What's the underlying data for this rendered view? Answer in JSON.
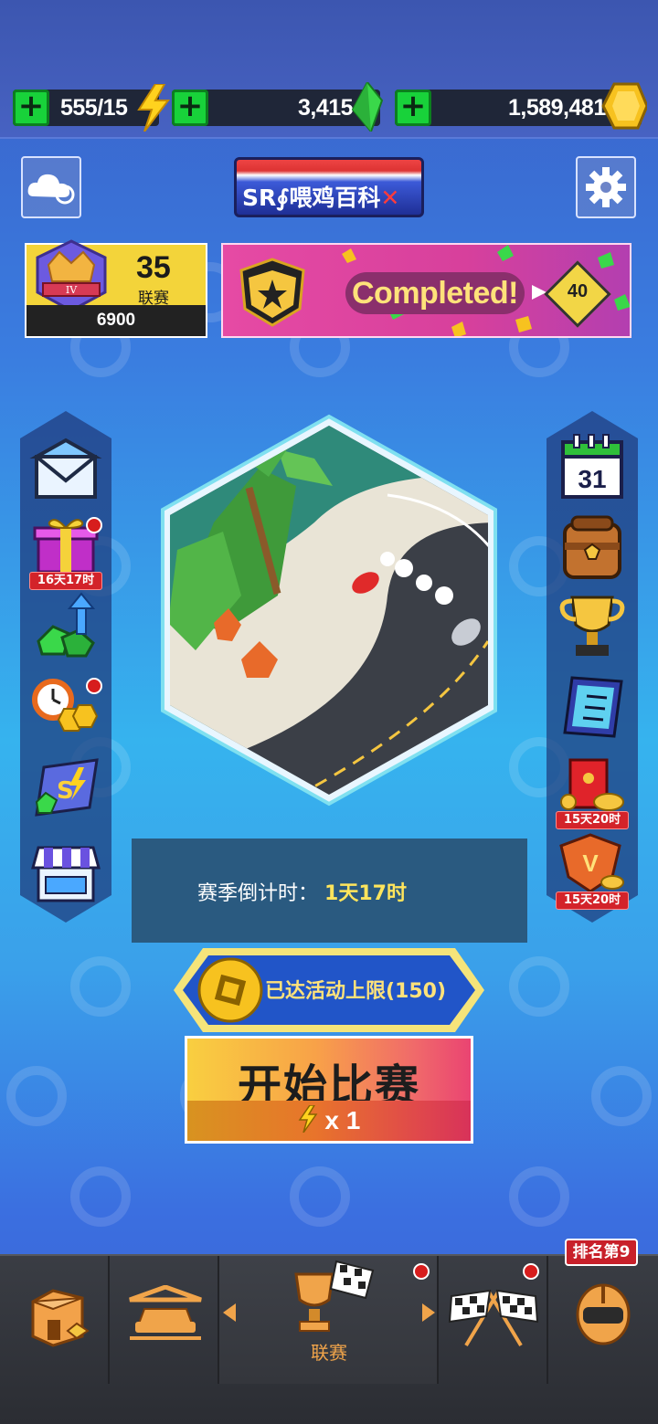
{
  "resources": {
    "energy": "555/15",
    "gems": "3,415",
    "coins": "1,589,481"
  },
  "banner": {
    "text": "SR∮喂鸡百科"
  },
  "league": {
    "rank_numeral": "IV",
    "number": "35",
    "label": "联赛",
    "score": "6900"
  },
  "challenge": {
    "status": "Completed!",
    "reward": "40"
  },
  "left_menu": [
    {
      "name": "mail",
      "timer": ""
    },
    {
      "name": "gift",
      "timer": "16天17时",
      "notify": true
    },
    {
      "name": "gem-upgrade",
      "timer": ""
    },
    {
      "name": "time-coins",
      "timer": "",
      "notify": true
    },
    {
      "name": "season-pass",
      "timer": ""
    },
    {
      "name": "shop",
      "timer": ""
    }
  ],
  "right_menu": [
    {
      "name": "calendar",
      "label": "31"
    },
    {
      "name": "backpack",
      "label": ""
    },
    {
      "name": "trophy",
      "label": ""
    },
    {
      "name": "checklist",
      "label": ""
    },
    {
      "name": "red-envelope",
      "timer": "15天20时"
    },
    {
      "name": "vip",
      "timer": "15天20时"
    }
  ],
  "season": {
    "label": "赛季倒计时：",
    "value": "1天17时"
  },
  "coin_limit": {
    "text": "已达活动上限(150)"
  },
  "start": {
    "label": "开始比赛",
    "cost": "x 1"
  },
  "nav": {
    "league_label": "联赛",
    "rank_badge": "排名第9"
  },
  "colors": {
    "accent_green": "#18d23a",
    "gold": "#f3d43a",
    "pink": "#e64aa4",
    "nav_label": "#f0a44a"
  }
}
